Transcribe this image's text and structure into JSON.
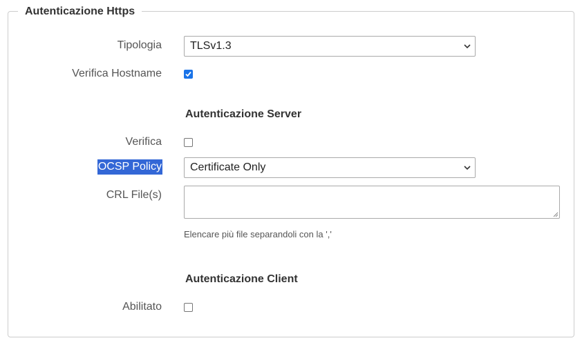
{
  "fieldset": {
    "legend": "Autenticazione Https"
  },
  "fields": {
    "tipologia": {
      "label": "Tipologia",
      "value": "TLSv1.3"
    },
    "verifica_hostname": {
      "label": "Verifica Hostname",
      "checked": true
    },
    "server_section_title": "Autenticazione Server",
    "verifica": {
      "label": "Verifica",
      "checked": false
    },
    "ocsp_policy": {
      "label": "OCSP Policy",
      "value": "Certificate Only"
    },
    "crl_files": {
      "label": "CRL File(s)",
      "value": "",
      "help": "Elencare più file separandoli con la ','"
    },
    "client_section_title": "Autenticazione Client",
    "abilitato": {
      "label": "Abilitato",
      "checked": false
    }
  },
  "colors": {
    "accent": "#1a73e8",
    "selection": "#3367d6"
  }
}
